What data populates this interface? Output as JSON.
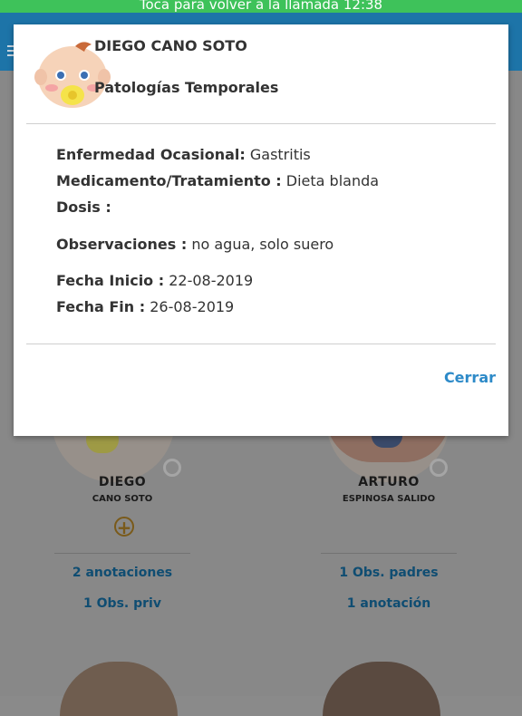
{
  "call_banner": {
    "text": "Toca para volver a la llamada 12:38"
  },
  "children": [
    {
      "first_name": "DIEGO",
      "surname": "CANO SOTO",
      "link_primary": "2 anotaciones",
      "link_secondary": "1 Obs. priv"
    },
    {
      "first_name": "ARTURO",
      "surname": "ESPINOSA SALIDO",
      "link_primary": "1 Obs. padres",
      "link_secondary": "1 anotación"
    }
  ],
  "modal": {
    "child_name": "DIEGO CANO SOTO",
    "subtitle": "Patologías Temporales",
    "fields": [
      {
        "label": "Enfermedad Ocasional:",
        "value": " Gastritis"
      },
      {
        "label": "Medicamento/Tratamiento :",
        "value": " Dieta blanda"
      },
      {
        "label": "Dosis :",
        "value": ""
      },
      {
        "label": "Observaciones :",
        "value": " no agua, solo suero"
      },
      {
        "label": "Fecha Inicio :",
        "value": " 22-08-2019"
      },
      {
        "label": "Fecha Fin :",
        "value": " 26-08-2019"
      }
    ],
    "close_label": "Cerrar"
  },
  "colors": {
    "call_banner": "#3ec25a",
    "header": "#1d74a8",
    "overlay_bg": "#888888",
    "link": "#2d8ac8",
    "add_button": "#e0a020"
  },
  "icons": {
    "menu": "hamburger-menu-icon",
    "add": "plus-circle-icon",
    "avatar": "baby-with-pacifier-avatar"
  }
}
